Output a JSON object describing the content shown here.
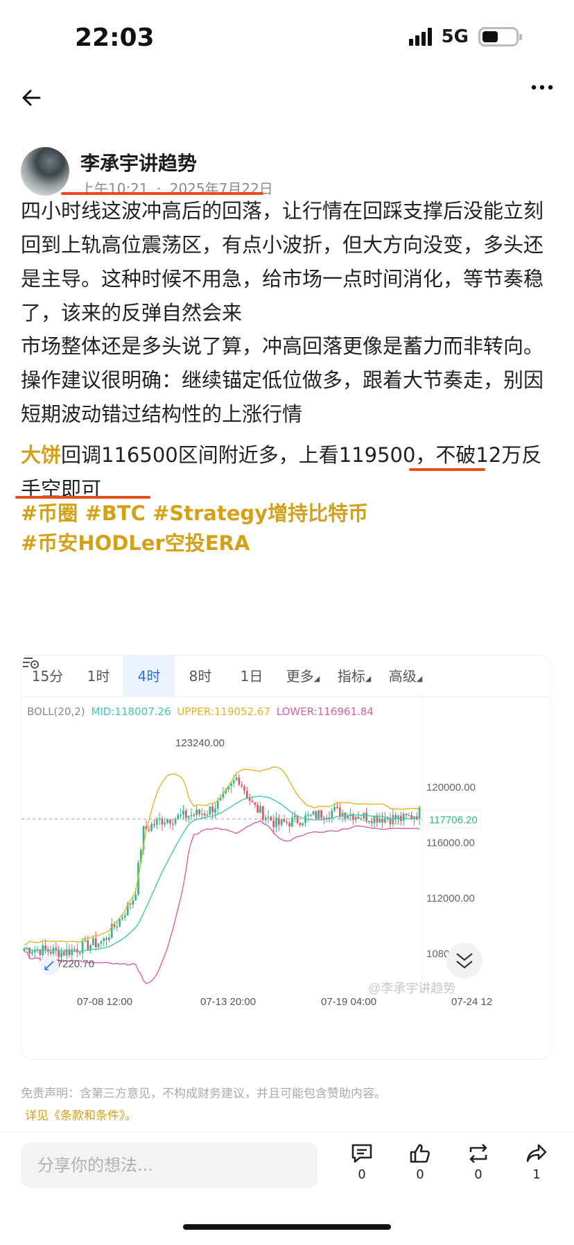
{
  "status_bar": {
    "time": "22:03",
    "network": "5G"
  },
  "post": {
    "author": "李承宇讲趋势",
    "time": "上午10:21",
    "date_sep": "·",
    "date": "2025年7月22日",
    "p1": "四小时线这波冲高后的回落，让行情在回踩支撑后没能立刻回到上轨高位震荡区，有点小波折，但大方向没变，多头还是主导。这种时候不用急，给市场一点时间消化，等节奏稳了，该来的反弹自然会来",
    "p2": "市场整体还是多头说了算，冲高回落更像是蓄力而非转向。操作建议很明确：继续锚定低位做多，跟着大节奏走，别因短期波动错过结构性的上涨行情",
    "p3_highlight": "大饼",
    "p3_text": "回调116500区间附近多，上看119500，不破12万反手空即可",
    "tag_line1": "#币圈 #BTC #Strategy增持比特币",
    "tag_line2": "#币安HODLer空投ERA"
  },
  "chart_tabs": [
    "15分",
    "1时",
    "4时",
    "8时",
    "1日",
    "更多",
    "指标",
    "高级"
  ],
  "chart_data": {
    "type": "candlestick",
    "indicator": "BOLL(20,2)",
    "mid": "MID:118007.26",
    "upper": "UPPER:119052.67",
    "lower": "LOWER:116961.84",
    "colors": {
      "mid": "#3ec9b0",
      "upper": "#e6b422",
      "lower": "#d85fa6",
      "up": "#2eb88a",
      "down": "#e25560"
    },
    "ylim": [
      105500,
      124500
    ],
    "y_ticks": [
      "120000.00",
      "116000.00",
      "112000.00",
      "108000.00"
    ],
    "current_price": "117706.20",
    "high_label": "123240.00",
    "low_label": "107220.70",
    "x_ticks": [
      "07-08 12:00",
      "07-13 20:00",
      "07-19 04:00",
      "07-24 12"
    ],
    "watermark": "@李承宇讲趋势"
  },
  "disclaimer": "免责声明：含第三方意见，不构成财务建议，并且可能包含赞助内容。",
  "terms": "详见《条款和条件》。",
  "bottom_bar": {
    "placeholder": "分享你的想法...",
    "comments": "0",
    "likes": "0",
    "reposts": "0",
    "shares": "1"
  }
}
